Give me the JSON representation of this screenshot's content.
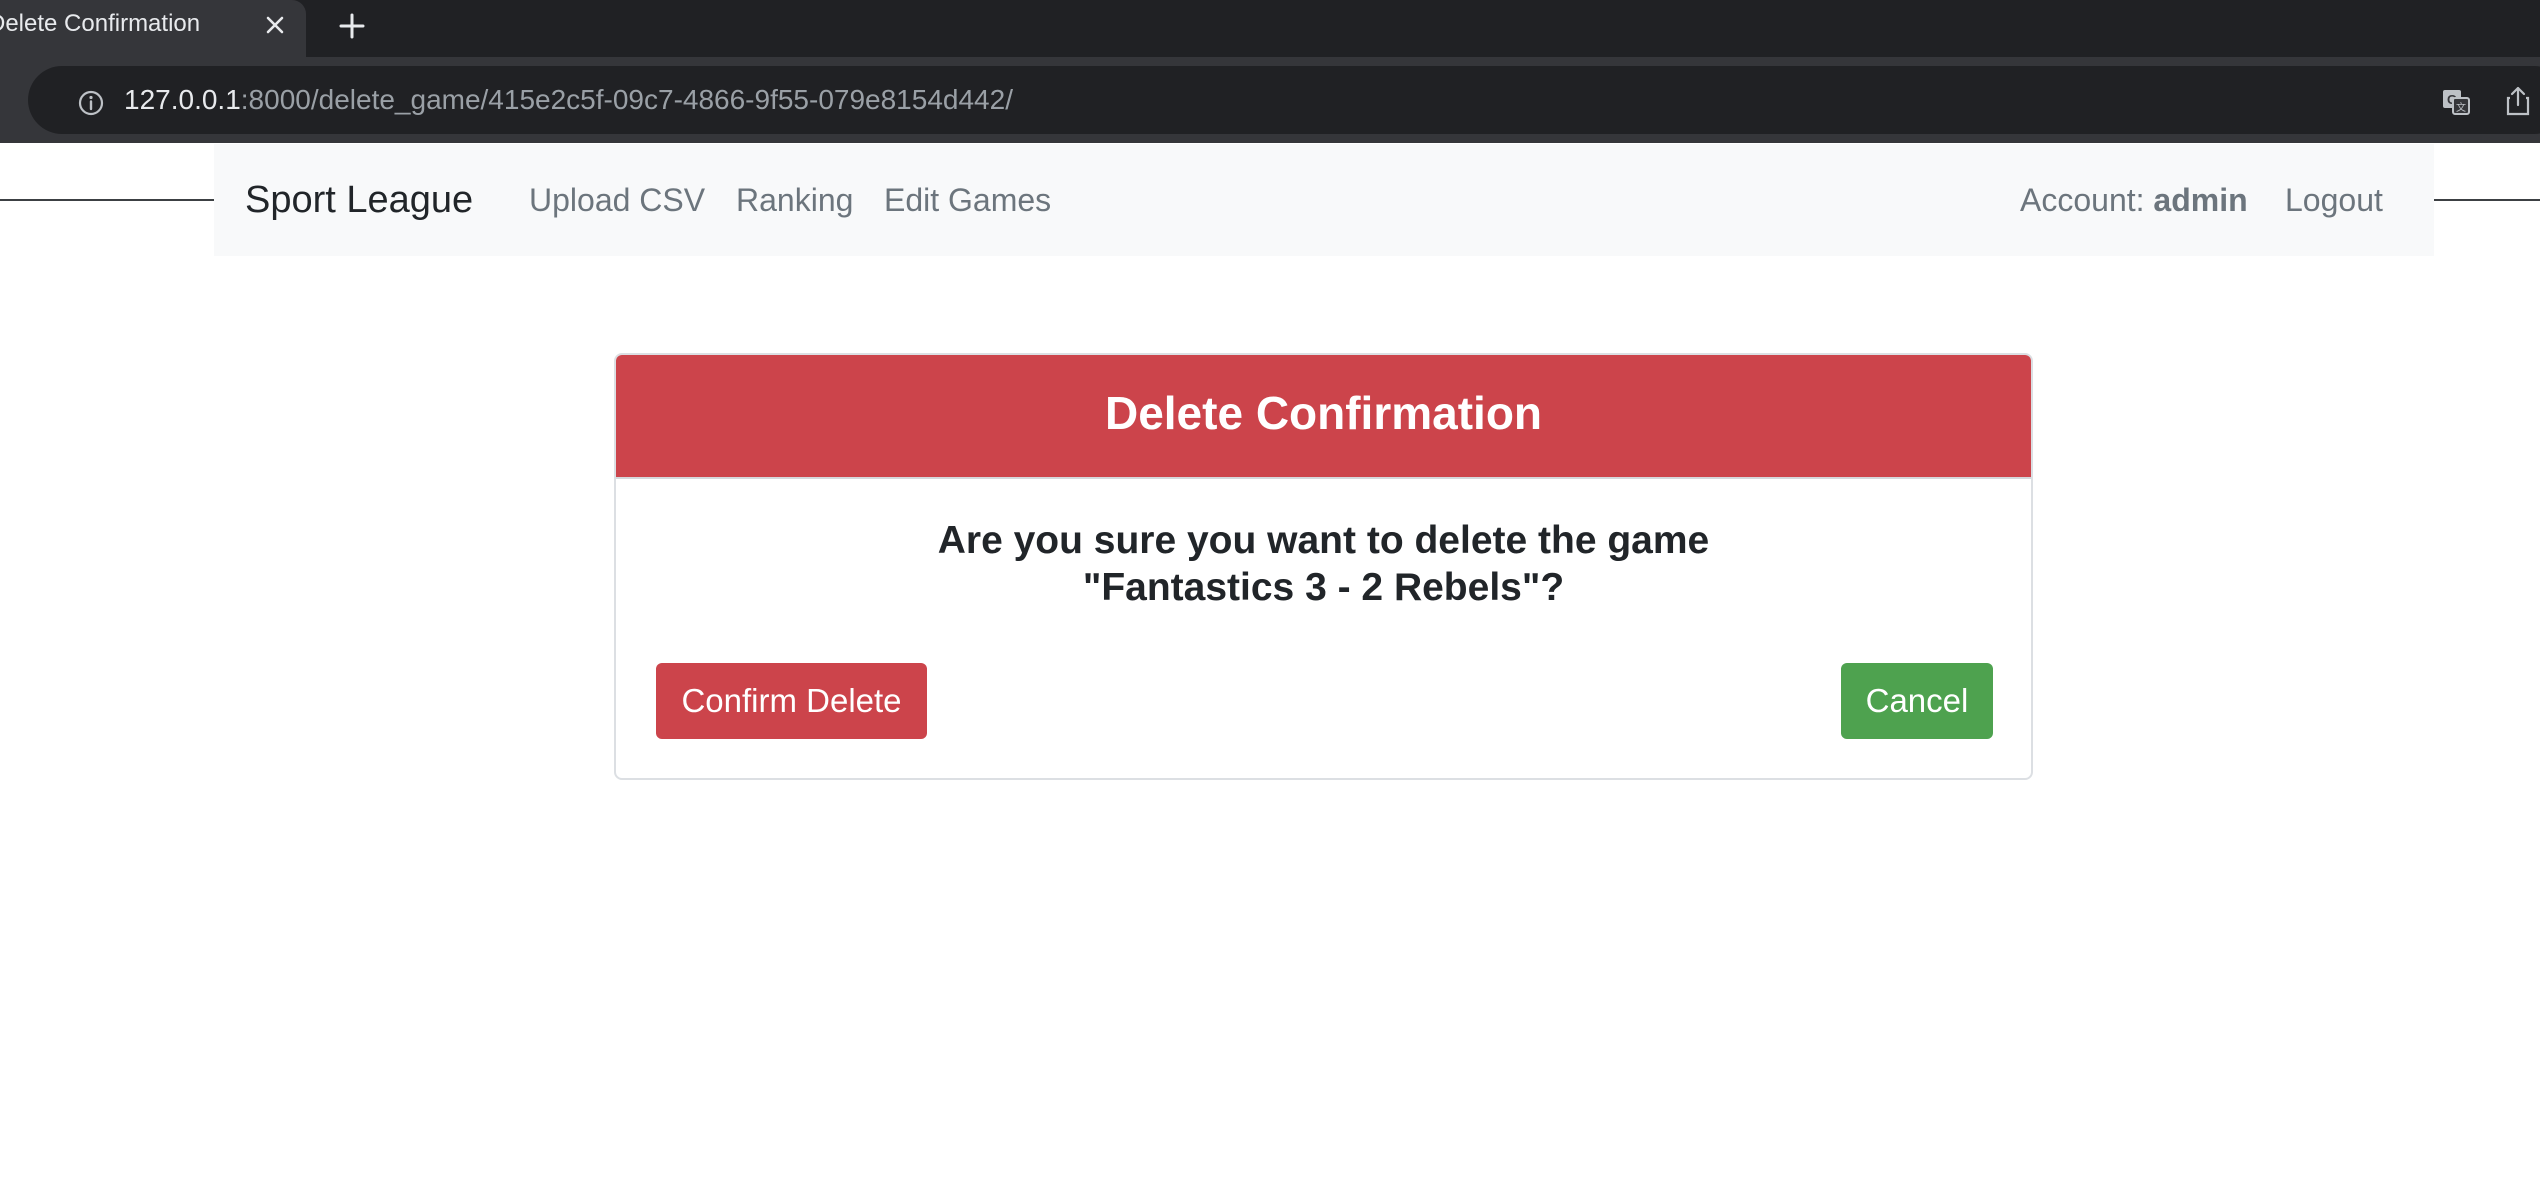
{
  "browser": {
    "tab_title": "Delete Confirmation",
    "url_host": "127.0.0.1",
    "url_path": ":8000/delete_game/415e2c5f-09c7-4866-9f55-079e8154d442/"
  },
  "navbar": {
    "brand": "Sport League",
    "links": [
      "Upload CSV",
      "Ranking",
      "Edit Games"
    ],
    "account_label": "Account:",
    "account_user": "admin",
    "logout": "Logout"
  },
  "dialog": {
    "title": "Delete Confirmation",
    "question": "Are you sure you want to delete the game",
    "game_name": "\"Fantastics 3 - 2 Rebels\"?",
    "confirm_label": "Confirm Delete",
    "cancel_label": "Cancel"
  },
  "colors": {
    "danger": "#cc444b",
    "success": "#4ea24f",
    "navbar_bg": "#f8f9fa",
    "nav_link": "#6c757d"
  },
  "icons": [
    "close-icon",
    "plus-icon",
    "info-icon",
    "translate-icon",
    "share-icon"
  ]
}
